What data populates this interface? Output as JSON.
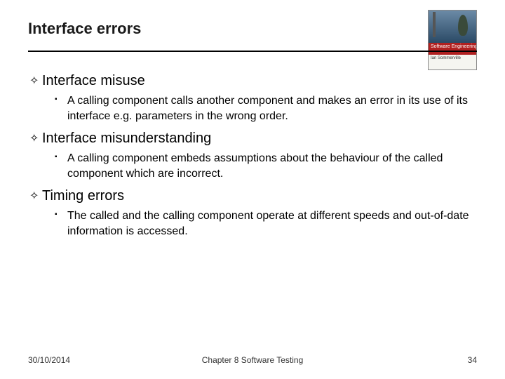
{
  "title": "Interface errors",
  "book": {
    "band": "Software Engineering",
    "author": "Ian Sommerville"
  },
  "sections": [
    {
      "heading": "Interface misuse",
      "items": [
        "A calling component calls another component and makes an error in its use of its interface e.g. parameters in the wrong order."
      ]
    },
    {
      "heading": "Interface misunderstanding",
      "items": [
        "A calling component embeds assumptions about the behaviour of the called component which are incorrect."
      ]
    },
    {
      "heading": "Timing errors",
      "items": [
        "The called and the calling component operate at different speeds and out-of-date information is accessed."
      ]
    }
  ],
  "footer": {
    "date": "30/10/2014",
    "chapter": "Chapter 8 Software Testing",
    "page": "34"
  }
}
